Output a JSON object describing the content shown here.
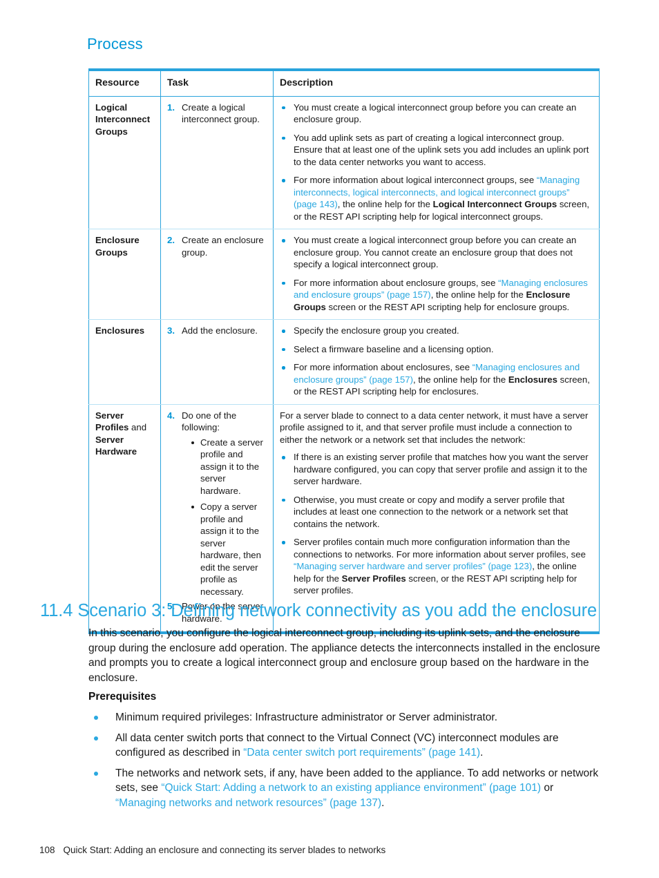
{
  "page": {
    "heading_process": "Process",
    "footer_page_number": "108",
    "footer_text": "Quick Start: Adding an enclosure and connecting its server blades to networks",
    "accent_color": "#0096d6",
    "link_color": "#2aa8e0",
    "table_border_color": "#29a3dc"
  },
  "table": {
    "headers": {
      "resource": "Resource",
      "task": "Task",
      "description": "Description"
    },
    "rows": [
      {
        "resource": "Logical Interconnect Groups",
        "steps": [
          {
            "num": "1.",
            "text": "Create a logical interconnect group."
          }
        ],
        "description_bullets": [
          {
            "parts": [
              {
                "type": "text",
                "text": "You must create a logical interconnect group before you can create an enclosure group."
              }
            ]
          },
          {
            "parts": [
              {
                "type": "text",
                "text": "You add uplink sets as part of creating a logical interconnect group. Ensure that at least one of the uplink sets you add includes an uplink port to the data center networks you want to access."
              }
            ]
          },
          {
            "parts": [
              {
                "type": "text",
                "text": "For more information about logical interconnect groups, see "
              },
              {
                "type": "link",
                "text": "“Managing interconnects, logical interconnects, and logical interconnect groups” (page 143)"
              },
              {
                "type": "text",
                "text": ", the online help for the "
              },
              {
                "type": "bold",
                "text": "Logical Interconnect Groups"
              },
              {
                "type": "text",
                "text": " screen, or the REST API scripting help for logical interconnect groups."
              }
            ]
          }
        ]
      },
      {
        "resource": "Enclosure Groups",
        "steps": [
          {
            "num": "2.",
            "text": "Create an enclosure group."
          }
        ],
        "description_bullets": [
          {
            "parts": [
              {
                "type": "text",
                "text": "You must create a logical interconnect group before you can create an enclosure group. You cannot create an enclosure group that does not specify a logical interconnect group."
              }
            ]
          },
          {
            "parts": [
              {
                "type": "text",
                "text": "For more information about enclosure groups, see "
              },
              {
                "type": "link",
                "text": "“Managing enclosures and enclosure groups” (page 157)"
              },
              {
                "type": "text",
                "text": ", the online help for the "
              },
              {
                "type": "bold",
                "text": "Enclosure Groups"
              },
              {
                "type": "text",
                "text": " screen or the REST API scripting help for enclosure groups."
              }
            ]
          }
        ]
      },
      {
        "resource": "Enclosures",
        "steps": [
          {
            "num": "3.",
            "text": "Add the enclosure."
          }
        ],
        "description_bullets": [
          {
            "parts": [
              {
                "type": "text",
                "text": "Specify the enclosure group you created."
              }
            ]
          },
          {
            "parts": [
              {
                "type": "text",
                "text": "Select a firmware baseline and a licensing option."
              }
            ]
          },
          {
            "parts": [
              {
                "type": "text",
                "text": "For more information about enclosures, see "
              },
              {
                "type": "link",
                "text": "“Managing enclosures and enclosure groups” (page 157)"
              },
              {
                "type": "text",
                "text": ", the online help for the "
              },
              {
                "type": "bold",
                "text": "Enclosures"
              },
              {
                "type": "text",
                "text": " screen, or the REST API scripting help for enclosures."
              }
            ]
          }
        ]
      },
      {
        "resource_parts": [
          {
            "type": "bold",
            "text": "Server Profiles"
          },
          {
            "type": "plain",
            "text": " and "
          },
          {
            "type": "bold",
            "text": "Server Hardware"
          }
        ],
        "steps": [
          {
            "num": "4.",
            "text": "Do one of the following:",
            "sub_bullets": [
              "Create a server profile and assign it to the server hardware.",
              "Copy a server profile and assign it to the server hardware, then edit the server profile as necessary."
            ]
          },
          {
            "num": "5.",
            "text": "Power on the server hardware."
          }
        ],
        "description_lead": "For a server blade to connect to a data center network, it must have a server profile assigned to it, and that server profile must include a connection to either the network or a network set that includes the network:",
        "description_bullets": [
          {
            "parts": [
              {
                "type": "text",
                "text": "If there is an existing server profile that matches how you want the server hardware configured, you can copy that server profile and assign it to the server hardware."
              }
            ]
          },
          {
            "parts": [
              {
                "type": "text",
                "text": "Otherwise, you must create or copy and modify a server profile that includes at least one connection to the network or a network set that contains the network."
              }
            ]
          },
          {
            "parts": [
              {
                "type": "text",
                "text": "Server profiles contain much more configuration information than the connections to networks. For more information about server profiles, see "
              },
              {
                "type": "link",
                "text": "“Managing server hardware and server profiles” (page 123)"
              },
              {
                "type": "text",
                "text": ", the online help for the "
              },
              {
                "type": "bold",
                "text": "Server Profiles"
              },
              {
                "type": "text",
                "text": " screen, or the REST API scripting help for server profiles."
              }
            ]
          }
        ]
      }
    ]
  },
  "section": {
    "heading": "11.4 Scenario 3: Defining network connectivity as you add the enclosure",
    "intro": "In this scenario, you configure the logical interconnect group, including its uplink sets, and the enclosure group during the enclosure add operation. The appliance detects the interconnects installed in the enclosure and prompts you to create a logical interconnect group and enclosure group based on the hardware in the enclosure.",
    "prerequisites_heading": "Prerequisites",
    "prerequisites": [
      {
        "parts": [
          {
            "type": "text",
            "text": "Minimum required privileges: Infrastructure administrator or Server administrator."
          }
        ]
      },
      {
        "parts": [
          {
            "type": "text",
            "text": "All data center switch ports that connect to the Virtual Connect (VC) interconnect modules are configured as described in "
          },
          {
            "type": "link",
            "text": "“Data center switch port requirements” (page 141)"
          },
          {
            "type": "text",
            "text": "."
          }
        ]
      },
      {
        "parts": [
          {
            "type": "text",
            "text": "The networks and network sets, if any, have been added to the appliance. To add networks or network sets, see "
          },
          {
            "type": "link",
            "text": "“Quick Start: Adding a network to an existing appliance environment” (page 101)"
          },
          {
            "type": "text",
            "text": " or "
          },
          {
            "type": "link",
            "text": "“Managing networks and network resources” (page 137)"
          },
          {
            "type": "text",
            "text": "."
          }
        ]
      }
    ]
  }
}
